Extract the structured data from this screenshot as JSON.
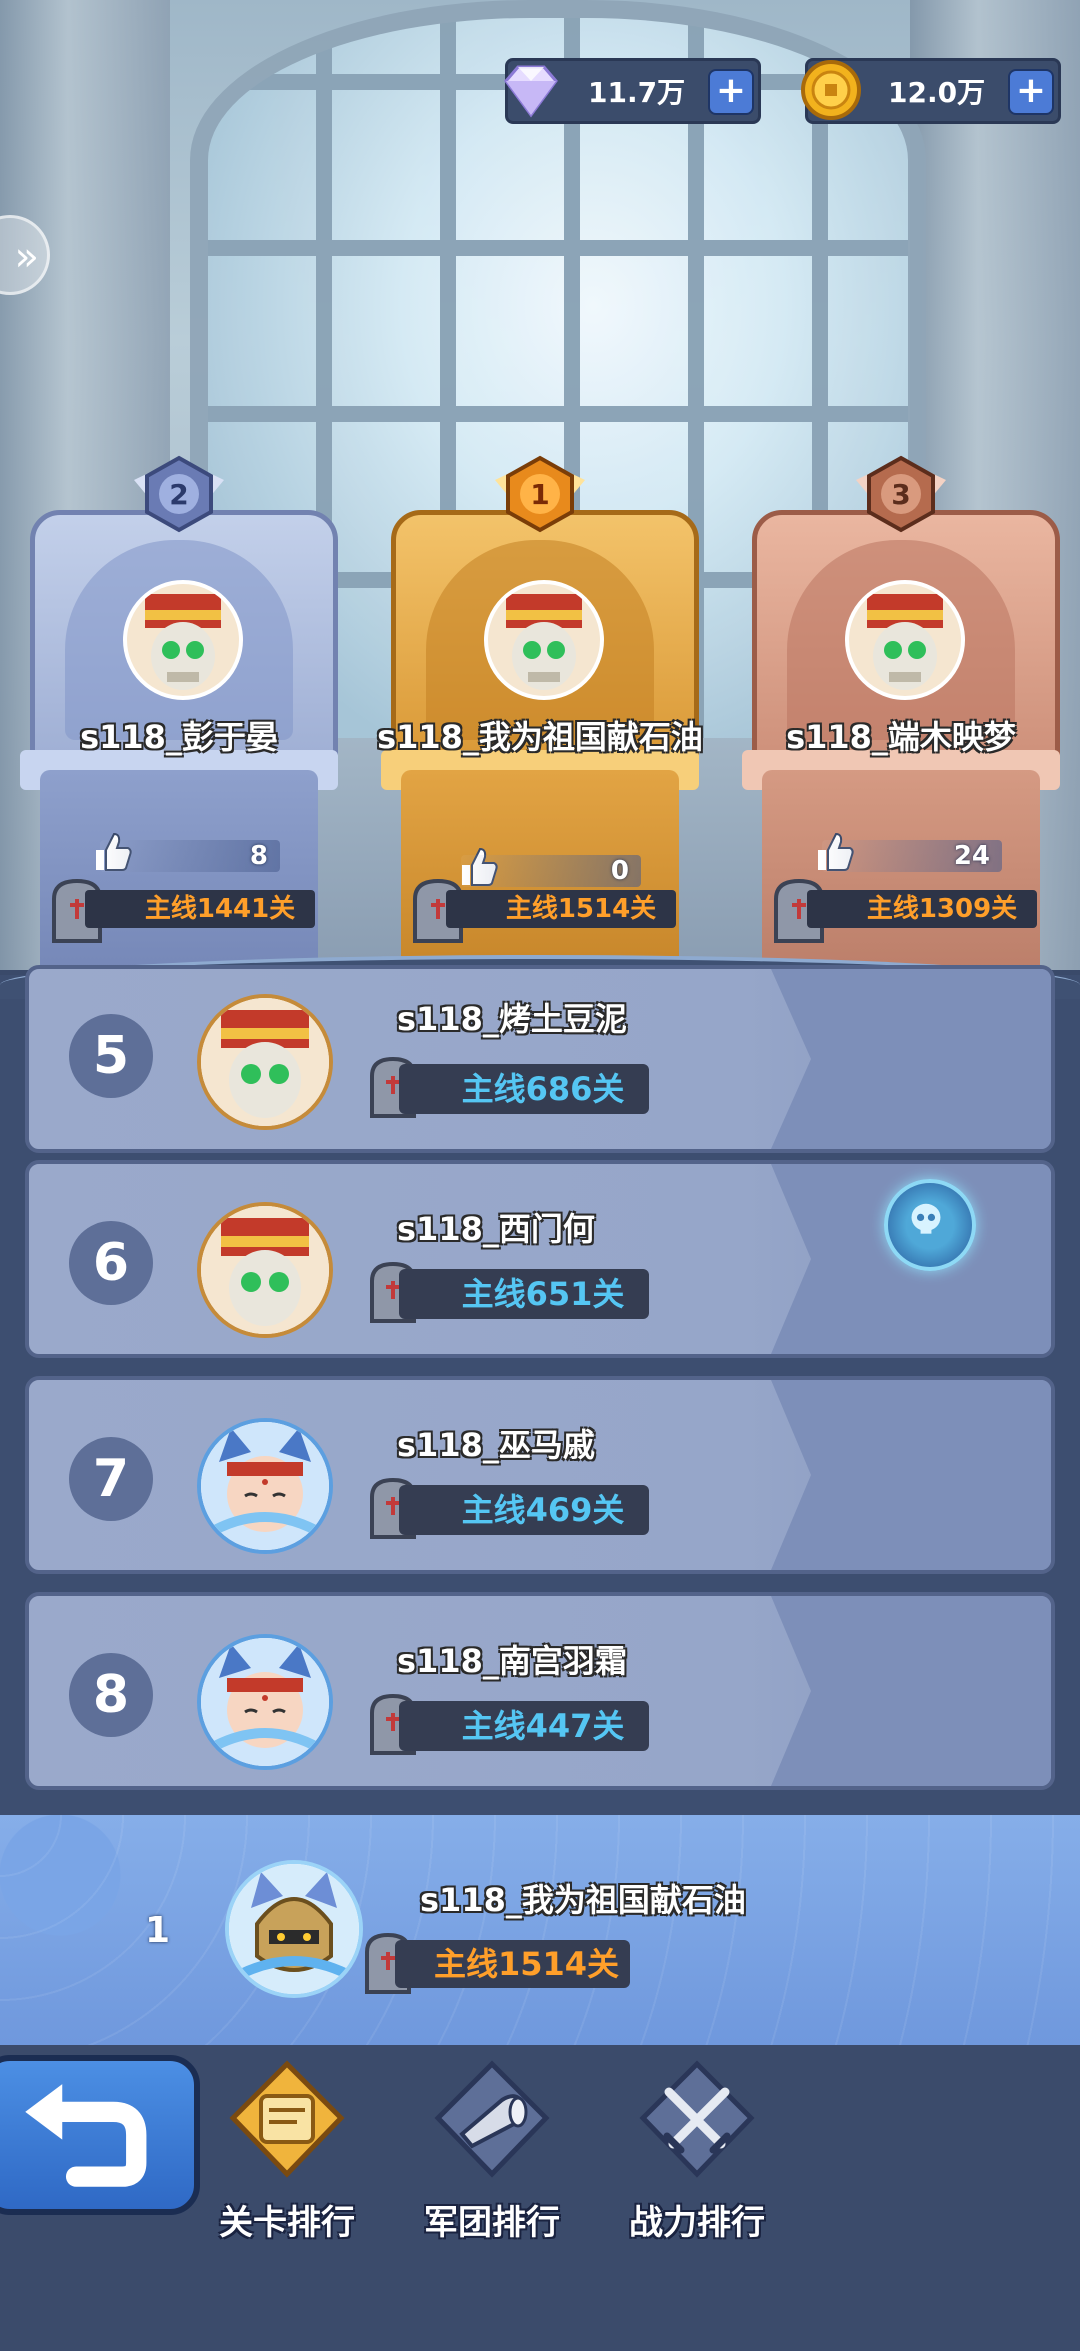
{
  "currency": {
    "gems": {
      "value": "11.7万",
      "icon": "diamond-icon"
    },
    "coins": {
      "value": "12.0万",
      "icon": "coin-icon"
    }
  },
  "podium": [
    {
      "rank": "2",
      "name": "s118_彭于晏",
      "likes": "8",
      "stage": "主线1441关"
    },
    {
      "rank": "1",
      "name": "s118_我为祖国献石油",
      "likes": "0",
      "stage": "主线1514关"
    },
    {
      "rank": "3",
      "name": "s118_端木映梦",
      "likes": "24",
      "stage": "主线1309关"
    }
  ],
  "rows": [
    {
      "rank": "5",
      "name": "s118_烤土豆泥",
      "stage": "主线686关"
    },
    {
      "rank": "6",
      "name": "s118_西门何",
      "stage": "主线651关"
    },
    {
      "rank": "7",
      "name": "s118_巫马戚",
      "stage": "主线469关"
    },
    {
      "rank": "8",
      "name": "s118_南宫羽霜",
      "stage": "主线447关"
    }
  ],
  "me": {
    "rank": "1",
    "name": "s118_我为祖国献石油",
    "stage": "主线1514关"
  },
  "nav": {
    "stage_rank": "关卡排行",
    "legion_rank": "军团排行",
    "power_rank": "战力排行"
  },
  "colors": {
    "gold": "#e8a43a",
    "silver": "#a8b6d8",
    "bronze": "#d49a82",
    "panel": "#3d4e70",
    "row": "#9aa9cb"
  }
}
